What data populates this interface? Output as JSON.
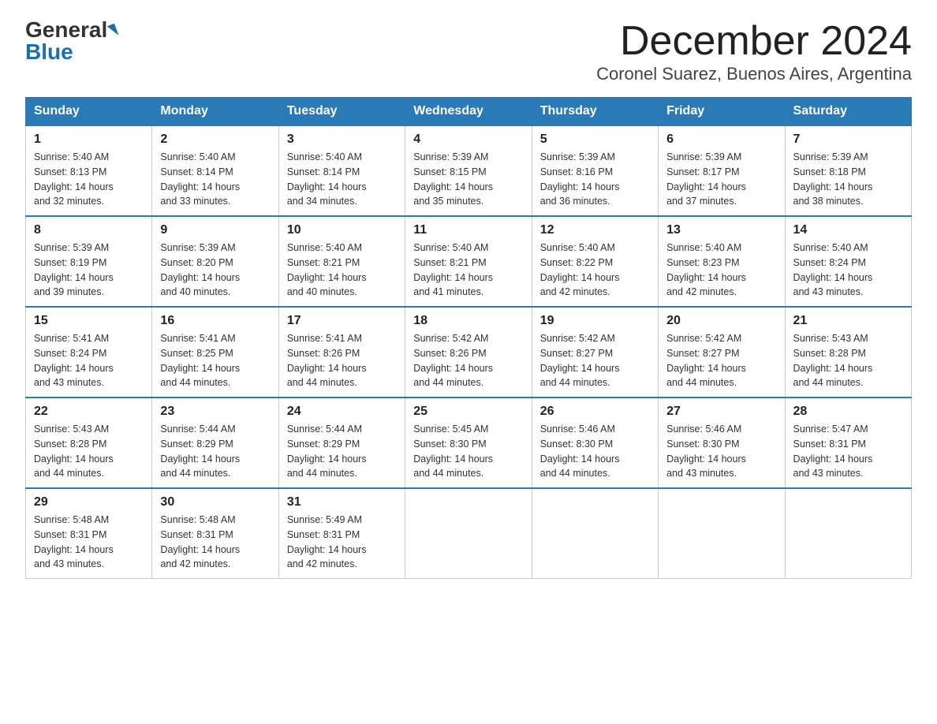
{
  "header": {
    "logo_general": "General",
    "logo_blue": "Blue",
    "month_title": "December 2024",
    "location": "Coronel Suarez, Buenos Aires, Argentina"
  },
  "days_of_week": [
    "Sunday",
    "Monday",
    "Tuesday",
    "Wednesday",
    "Thursday",
    "Friday",
    "Saturday"
  ],
  "weeks": [
    [
      {
        "day": "1",
        "sunrise": "5:40 AM",
        "sunset": "8:13 PM",
        "daylight": "14 hours and 32 minutes."
      },
      {
        "day": "2",
        "sunrise": "5:40 AM",
        "sunset": "8:14 PM",
        "daylight": "14 hours and 33 minutes."
      },
      {
        "day": "3",
        "sunrise": "5:40 AM",
        "sunset": "8:14 PM",
        "daylight": "14 hours and 34 minutes."
      },
      {
        "day": "4",
        "sunrise": "5:39 AM",
        "sunset": "8:15 PM",
        "daylight": "14 hours and 35 minutes."
      },
      {
        "day": "5",
        "sunrise": "5:39 AM",
        "sunset": "8:16 PM",
        "daylight": "14 hours and 36 minutes."
      },
      {
        "day": "6",
        "sunrise": "5:39 AM",
        "sunset": "8:17 PM",
        "daylight": "14 hours and 37 minutes."
      },
      {
        "day": "7",
        "sunrise": "5:39 AM",
        "sunset": "8:18 PM",
        "daylight": "14 hours and 38 minutes."
      }
    ],
    [
      {
        "day": "8",
        "sunrise": "5:39 AM",
        "sunset": "8:19 PM",
        "daylight": "14 hours and 39 minutes."
      },
      {
        "day": "9",
        "sunrise": "5:39 AM",
        "sunset": "8:20 PM",
        "daylight": "14 hours and 40 minutes."
      },
      {
        "day": "10",
        "sunrise": "5:40 AM",
        "sunset": "8:21 PM",
        "daylight": "14 hours and 40 minutes."
      },
      {
        "day": "11",
        "sunrise": "5:40 AM",
        "sunset": "8:21 PM",
        "daylight": "14 hours and 41 minutes."
      },
      {
        "day": "12",
        "sunrise": "5:40 AM",
        "sunset": "8:22 PM",
        "daylight": "14 hours and 42 minutes."
      },
      {
        "day": "13",
        "sunrise": "5:40 AM",
        "sunset": "8:23 PM",
        "daylight": "14 hours and 42 minutes."
      },
      {
        "day": "14",
        "sunrise": "5:40 AM",
        "sunset": "8:24 PM",
        "daylight": "14 hours and 43 minutes."
      }
    ],
    [
      {
        "day": "15",
        "sunrise": "5:41 AM",
        "sunset": "8:24 PM",
        "daylight": "14 hours and 43 minutes."
      },
      {
        "day": "16",
        "sunrise": "5:41 AM",
        "sunset": "8:25 PM",
        "daylight": "14 hours and 44 minutes."
      },
      {
        "day": "17",
        "sunrise": "5:41 AM",
        "sunset": "8:26 PM",
        "daylight": "14 hours and 44 minutes."
      },
      {
        "day": "18",
        "sunrise": "5:42 AM",
        "sunset": "8:26 PM",
        "daylight": "14 hours and 44 minutes."
      },
      {
        "day": "19",
        "sunrise": "5:42 AM",
        "sunset": "8:27 PM",
        "daylight": "14 hours and 44 minutes."
      },
      {
        "day": "20",
        "sunrise": "5:42 AM",
        "sunset": "8:27 PM",
        "daylight": "14 hours and 44 minutes."
      },
      {
        "day": "21",
        "sunrise": "5:43 AM",
        "sunset": "8:28 PM",
        "daylight": "14 hours and 44 minutes."
      }
    ],
    [
      {
        "day": "22",
        "sunrise": "5:43 AM",
        "sunset": "8:28 PM",
        "daylight": "14 hours and 44 minutes."
      },
      {
        "day": "23",
        "sunrise": "5:44 AM",
        "sunset": "8:29 PM",
        "daylight": "14 hours and 44 minutes."
      },
      {
        "day": "24",
        "sunrise": "5:44 AM",
        "sunset": "8:29 PM",
        "daylight": "14 hours and 44 minutes."
      },
      {
        "day": "25",
        "sunrise": "5:45 AM",
        "sunset": "8:30 PM",
        "daylight": "14 hours and 44 minutes."
      },
      {
        "day": "26",
        "sunrise": "5:46 AM",
        "sunset": "8:30 PM",
        "daylight": "14 hours and 44 minutes."
      },
      {
        "day": "27",
        "sunrise": "5:46 AM",
        "sunset": "8:30 PM",
        "daylight": "14 hours and 43 minutes."
      },
      {
        "day": "28",
        "sunrise": "5:47 AM",
        "sunset": "8:31 PM",
        "daylight": "14 hours and 43 minutes."
      }
    ],
    [
      {
        "day": "29",
        "sunrise": "5:48 AM",
        "sunset": "8:31 PM",
        "daylight": "14 hours and 43 minutes."
      },
      {
        "day": "30",
        "sunrise": "5:48 AM",
        "sunset": "8:31 PM",
        "daylight": "14 hours and 42 minutes."
      },
      {
        "day": "31",
        "sunrise": "5:49 AM",
        "sunset": "8:31 PM",
        "daylight": "14 hours and 42 minutes."
      },
      null,
      null,
      null,
      null
    ]
  ],
  "labels": {
    "sunrise": "Sunrise:",
    "sunset": "Sunset:",
    "daylight": "Daylight:"
  }
}
